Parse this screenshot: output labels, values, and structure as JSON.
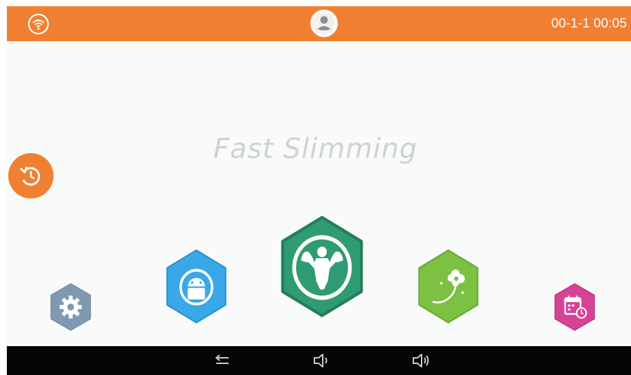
{
  "status_bar": {
    "time": "00-1-1 00:05",
    "bg_color": "#f17f32",
    "icons": [
      "wifi-icon",
      "user-avatar-icon"
    ]
  },
  "main": {
    "title": "Fast Slimming",
    "reset_icon": "reset-icon",
    "apps": [
      {
        "name": "settings",
        "icon": "gear-icon",
        "color": "#7f9ab0"
      },
      {
        "name": "android",
        "icon": "android-icon",
        "color": "#3aa8e8"
      },
      {
        "name": "fitness",
        "icon": "muscle-man-icon",
        "color": "#2f9b72"
      },
      {
        "name": "flower",
        "icon": "flower-icon",
        "color": "#7cc142"
      },
      {
        "name": "calendar",
        "icon": "calendar-clock-icon",
        "color": "#d64396"
      }
    ]
  },
  "nav_bar": {
    "buttons": [
      "back-icon",
      "volume-down-icon",
      "volume-up-icon"
    ]
  }
}
